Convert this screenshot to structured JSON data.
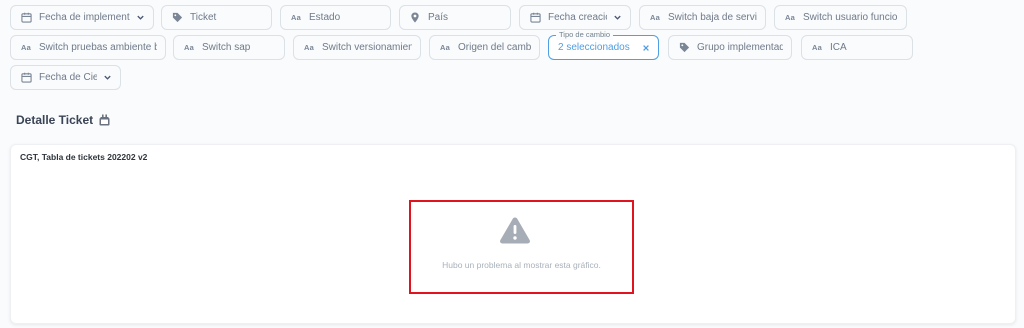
{
  "filters": {
    "fecha_implementacion": "Fecha de implementación",
    "ticket": "Ticket",
    "estado": "Estado",
    "pais": "País",
    "fecha_creacion": "Fecha creación",
    "switch_baja_servicio": "Switch baja de servicio",
    "switch_usuario_funcional": "Switch usuario funcional",
    "switch_pruebas_ambiente_bajo": "Switch pruebas ambiente bajo",
    "switch_sap": "Switch sap",
    "switch_versionamiento": "Switch versionamiento",
    "origen_del_cambio": "Origen del cambio",
    "tipo_de_cambio": {
      "legend": "Tipo de cambio",
      "value": "2 seleccionados"
    },
    "grupo_implementador": "Grupo implementador",
    "ica": "ICA",
    "fecha_de_cierre": "Fecha de Cierre",
    "text_type_glyph": "Aa"
  },
  "section": {
    "title": "Detalle Ticket"
  },
  "card": {
    "title": "CGT, Tabla de tickets 202202 v2",
    "error_message": "Hubo un problema al mostrar esta gráfico."
  },
  "colors": {
    "accent": "#509ee3",
    "error_outline": "#e0141e",
    "muted_text": "#a9b1bb",
    "warning_icon": "#a7adb6"
  },
  "icons": {
    "calendar": "calendar-icon",
    "tag": "tag-icon",
    "location": "location-pin-icon",
    "text": "text-type-icon",
    "chevron": "chevron-down-icon",
    "close": "close-icon",
    "warning": "warning-icon"
  }
}
